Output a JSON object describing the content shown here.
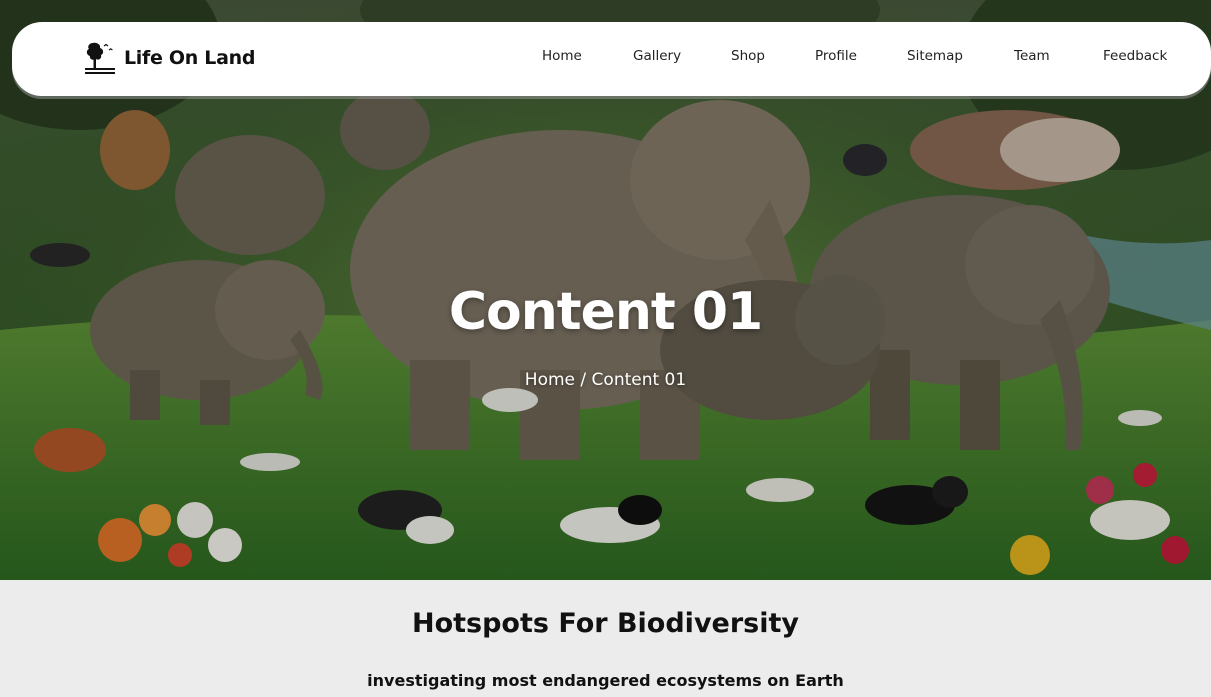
{
  "brand": {
    "name": "Life On Land",
    "logo_icon": "tree-birds-icon"
  },
  "nav": {
    "items": [
      {
        "label": "Home"
      },
      {
        "label": "Gallery"
      },
      {
        "label": "Shop"
      },
      {
        "label": "Profile"
      },
      {
        "label": "Sitemap"
      },
      {
        "label": "Team"
      },
      {
        "label": "Feedback"
      }
    ]
  },
  "hero": {
    "title": "Content 01",
    "breadcrumb": {
      "home": "Home",
      "separator": " / ",
      "current": "Content 01"
    }
  },
  "section": {
    "title": "Hotspots For Biodiversity",
    "subtitle": "investigating most endangered ecosystems on Earth"
  },
  "colors": {
    "nav_bg": "#ffffff",
    "content_bg": "#ececec",
    "text_dark": "#111111",
    "hero_text": "#ffffff"
  }
}
